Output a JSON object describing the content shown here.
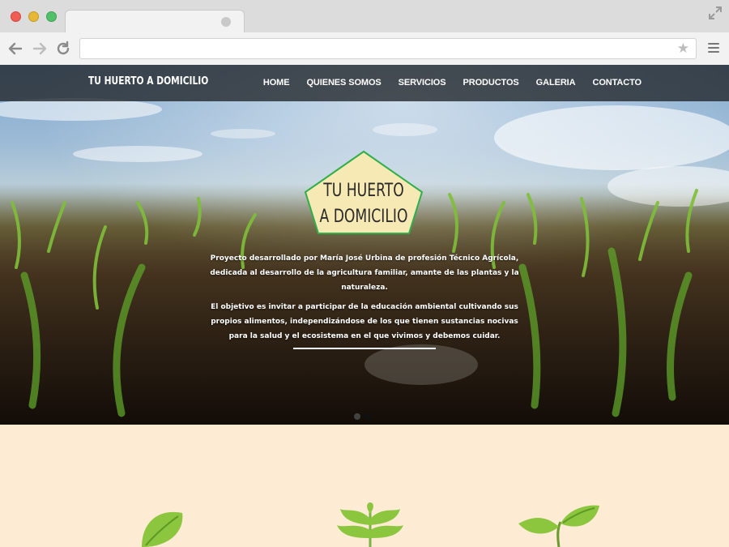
{
  "browser": {
    "url": "",
    "icons": {
      "back": "arrow-left-icon",
      "forward": "arrow-right-icon",
      "reload": "reload-icon",
      "bookmark": "star-icon",
      "menu": "hamburger-menu-icon",
      "fullscreen": "expand-icon"
    }
  },
  "site": {
    "brand": "TU HUERTO A DOMICILIO",
    "menu": [
      "HOME",
      "QUIENES SOMOS",
      "SERVICIOS",
      "PRODUCTOS",
      "GALERIA",
      "CONTACTO"
    ]
  },
  "hero": {
    "logo_line1": "TU HUERTO",
    "logo_line2": "A DOMICILIO",
    "paragraph1": "Proyecto desarrollado por María José Urbina de profesión Técnico Agrícola, dedicada al desarrollo de la agricultura familiar, amante de las plantas y la naturaleza.",
    "paragraph2": "El objetivo es invitar a participar de la educación ambiental cultivando sus propios alimentos, independizándose de los que tienen sustancias nocivas para la salud y el ecosistema en el que vivimos y debemos cuidar.",
    "slides_total": 2,
    "slide_active": 2
  },
  "colors": {
    "nav_bg": "#202428",
    "lower_bg": "#fdebd3",
    "logo_fill": "#f7e9b4",
    "logo_border": "#2fae49",
    "leaf_green": "#8cc63f"
  }
}
